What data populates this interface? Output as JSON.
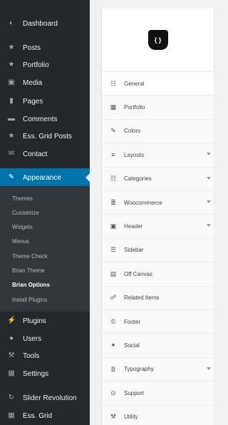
{
  "sidebar": {
    "items": [
      {
        "label": "Dashboard",
        "icon": "dashboard-icon",
        "glyph": "◐"
      },
      {
        "label": "Posts",
        "icon": "pin-icon",
        "glyph": "★"
      },
      {
        "label": "Portfolio",
        "icon": "pin-icon",
        "glyph": "★"
      },
      {
        "label": "Media",
        "icon": "media-icon",
        "glyph": "▣"
      },
      {
        "label": "Pages",
        "icon": "pages-icon",
        "glyph": "▮"
      },
      {
        "label": "Comments",
        "icon": "comment-icon",
        "glyph": "▬"
      },
      {
        "label": "Ess. Grid Posts",
        "icon": "pin-icon",
        "glyph": "★"
      },
      {
        "label": "Contact",
        "icon": "mail-icon",
        "glyph": "✉"
      }
    ],
    "appearance": {
      "label": "Appearance",
      "icon": "brush-icon",
      "glyph": "✎"
    },
    "submenu": [
      "Themes",
      "Customize",
      "Widgets",
      "Menus",
      "Theme Check",
      "Brian Theme",
      "Brian Options",
      "Install Plugins"
    ],
    "submenu_current": "Brian Options",
    "bottom_items": [
      {
        "label": "Plugins",
        "icon": "plug-icon",
        "glyph": "⚡"
      },
      {
        "label": "Users",
        "icon": "user-icon",
        "glyph": "●"
      },
      {
        "label": "Tools",
        "icon": "wrench-icon",
        "glyph": "⚒"
      },
      {
        "label": "Settings",
        "icon": "settings-icon",
        "glyph": "▦"
      },
      {
        "label": "Slider Revolution",
        "icon": "refresh-icon",
        "glyph": "↻"
      },
      {
        "label": "Ess. Grid",
        "icon": "grid-icon",
        "glyph": "▦"
      }
    ]
  },
  "panel": {
    "logo_text": "{ }",
    "tabs": [
      {
        "label": "General",
        "icon": "sitemap-icon",
        "glyph": "☷",
        "active": true,
        "caret": false
      },
      {
        "label": "Portfolio",
        "icon": "grid-icon",
        "glyph": "▦",
        "active": false,
        "caret": false
      },
      {
        "label": "Colors",
        "icon": "brush-icon",
        "glyph": "✎",
        "active": false,
        "caret": false
      },
      {
        "label": "Layouts",
        "icon": "layouts-icon",
        "glyph": "≡",
        "active": false,
        "caret": true
      },
      {
        "label": "Categories",
        "icon": "sitemap-icon",
        "glyph": "☷",
        "active": false,
        "caret": true
      },
      {
        "label": "Woocommerce",
        "icon": "cart-icon",
        "glyph": "≣",
        "active": false,
        "caret": true
      },
      {
        "label": "Header",
        "icon": "camera-icon",
        "glyph": "▣",
        "active": false,
        "caret": true
      },
      {
        "label": "Sidebar",
        "icon": "list-icon",
        "glyph": "☰",
        "active": false,
        "caret": false
      },
      {
        "label": "Off Canvas",
        "icon": "window-icon",
        "glyph": "▤",
        "active": false,
        "caret": false
      },
      {
        "label": "Related Items",
        "icon": "share-icon",
        "glyph": "☍",
        "active": false,
        "caret": false
      },
      {
        "label": "Footer",
        "icon": "copyright-icon",
        "glyph": "©",
        "active": false,
        "caret": false
      },
      {
        "label": "Social",
        "icon": "twitter-icon",
        "glyph": "✦",
        "active": false,
        "caret": false
      },
      {
        "label": "Typography",
        "icon": "font-icon",
        "glyph": "B",
        "active": false,
        "caret": true
      },
      {
        "label": "Support",
        "icon": "lifebuoy-icon",
        "glyph": "⊙",
        "active": false,
        "caret": false
      },
      {
        "label": "Utility",
        "icon": "tools-icon",
        "glyph": "⚒",
        "active": false,
        "caret": false
      }
    ]
  }
}
